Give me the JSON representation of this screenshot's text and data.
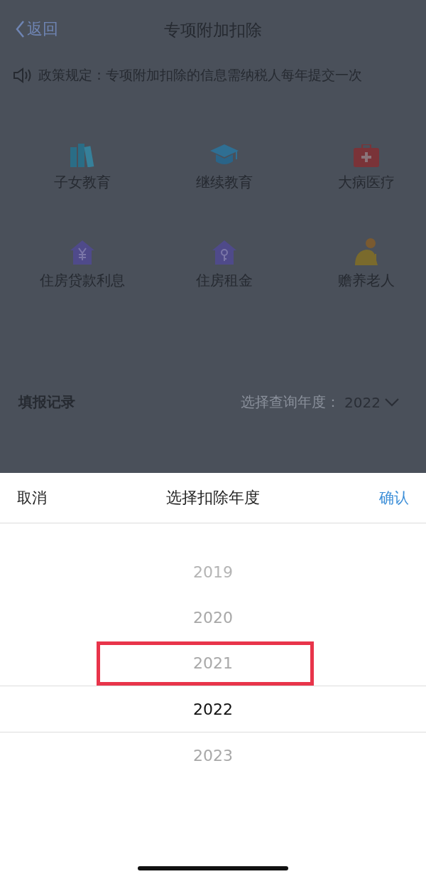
{
  "nav": {
    "back": "返回",
    "title": "专项附加扣除"
  },
  "notice": "政策规定：专项附加扣除的信息需纳税人每年提交一次",
  "categories": [
    {
      "label": "子女教育",
      "kind": "books"
    },
    {
      "label": "继续教育",
      "kind": "cap"
    },
    {
      "label": "大病医疗",
      "kind": "medkit"
    },
    {
      "label": "住房贷款利息",
      "kind": "house-yen"
    },
    {
      "label": "住房租金",
      "kind": "house-key"
    },
    {
      "label": "赡养老人",
      "kind": "elder"
    }
  ],
  "records": {
    "title": "填报记录",
    "query_label": "选择查询年度：",
    "query_year": "2022"
  },
  "sheet": {
    "cancel": "取消",
    "title": "选择扣除年度",
    "confirm": "确认",
    "years": [
      {
        "label": "2019",
        "selected": false,
        "highlighted": false
      },
      {
        "label": "2020",
        "selected": false,
        "highlighted": false
      },
      {
        "label": "2021",
        "selected": false,
        "highlighted": true
      },
      {
        "label": "2022",
        "selected": true,
        "highlighted": false
      },
      {
        "label": "2023",
        "selected": false,
        "highlighted": false
      }
    ]
  }
}
